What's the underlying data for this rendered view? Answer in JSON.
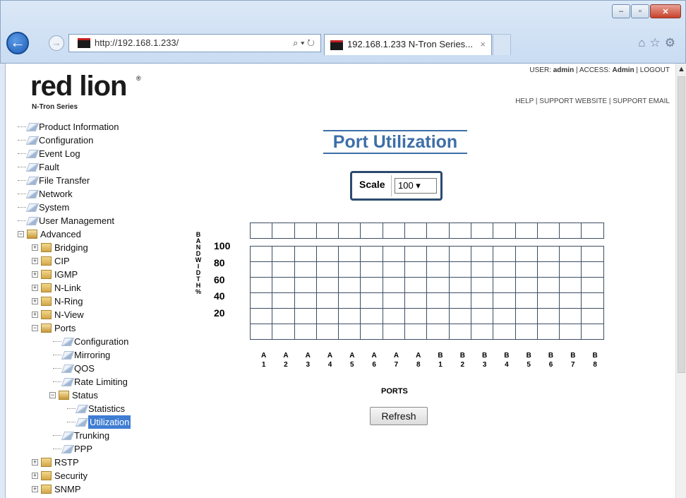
{
  "browser": {
    "url": "http://192.168.1.233/",
    "address_tools": "⌕ ▾ ↻",
    "tab_title": "192.168.1.233 N-Tron Series...",
    "tab_close": "×",
    "window_buttons": [
      "minimize",
      "maximize",
      "close"
    ],
    "nav_icons": [
      "home-icon",
      "star-icon",
      "gear-icon"
    ]
  },
  "logo": {
    "brand": "red lion",
    "sub": "N-Tron Series"
  },
  "header": {
    "user_label": "USER:",
    "user": "admin",
    "access_label": "ACCESS:",
    "access": "Admin",
    "logout": "LOGOUT",
    "help": "HELP",
    "support_website": "SUPPORT WEBSITE",
    "support_email": "SUPPORT EMAIL"
  },
  "tree": {
    "items": [
      "Product Information",
      "Configuration",
      "Event Log",
      "Fault",
      "File Transfer",
      "Network",
      "System",
      "User Management",
      "Advanced",
      "Bridging",
      "CIP",
      "IGMP",
      "N-Link",
      "N-Ring",
      "N-View",
      "Ports",
      "Configuration",
      "Mirroring",
      "QOS",
      "Rate Limiting",
      "Status",
      "Statistics",
      "Utilization",
      "Trunking",
      "PPP",
      "RSTP",
      "Security",
      "SNMP"
    ]
  },
  "main": {
    "title": "Port Utilization",
    "scale_label": "Scale",
    "scale_value": "100 ▾",
    "y_axis_letters": [
      "B",
      "A",
      "N",
      "D",
      "W",
      "I",
      "D",
      "T",
      "H",
      "%"
    ],
    "y_ticks": [
      "100",
      "80",
      "60",
      "40",
      "20"
    ],
    "ports_label": "PORTS",
    "refresh_label": "Refresh",
    "port_letters": [
      "A",
      "A",
      "A",
      "A",
      "A",
      "A",
      "A",
      "A",
      "B",
      "B",
      "B",
      "B",
      "B",
      "B",
      "B",
      "B"
    ],
    "port_numbers": [
      "1",
      "2",
      "3",
      "4",
      "5",
      "6",
      "7",
      "8",
      "1",
      "2",
      "3",
      "4",
      "5",
      "6",
      "7",
      "8"
    ]
  }
}
